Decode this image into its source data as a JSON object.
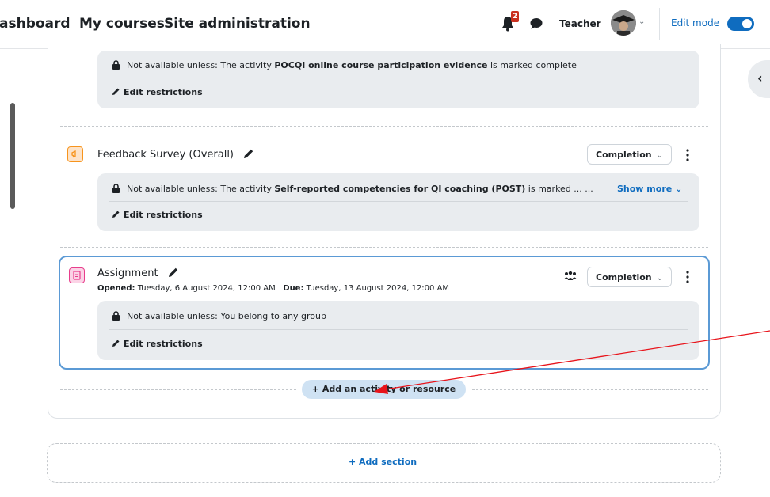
{
  "navbar": {
    "dashboard_label": "ashboard",
    "my_courses_label": "My courses",
    "site_admin_label": "Site administration",
    "notification_count": "2",
    "user_name": "Teacher",
    "edit_mode_label": "Edit mode",
    "edit_mode_on": true
  },
  "top_restriction": {
    "prefix": "Not available unless: The activity ",
    "activity": "POCQI online course participation evidence",
    "suffix": " is marked complete",
    "edit_label": "Edit restrictions"
  },
  "feedback": {
    "title": "Feedback Survey (Overall)",
    "completion_label": "Completion",
    "restriction_prefix": "Not available unless: The activity ",
    "restriction_activity": "Self-reported competencies for QI coaching (POST)",
    "restriction_suffix": " is marked ... ...",
    "show_more_label": "Show more",
    "edit_label": "Edit restrictions"
  },
  "assignment": {
    "title": "Assignment",
    "opened_label": "Opened:",
    "opened_value": "Tuesday, 6 August 2024, 12:00 AM",
    "due_label": "Due:",
    "due_value": "Tuesday, 13 August 2024, 12:00 AM",
    "completion_label": "Completion",
    "restriction_text": "Not available unless: You belong to any group",
    "edit_label": "Edit restrictions"
  },
  "add_activity_label": "+ Add an activity or resource",
  "add_section_label": "+ Add section",
  "colors": {
    "accent": "#0f6cbf",
    "feedback_icon": "#f7941d",
    "assignment_icon": "#e83e8c",
    "selected_border": "#5b9ad5",
    "annotation_arrow": "#e8141b"
  }
}
